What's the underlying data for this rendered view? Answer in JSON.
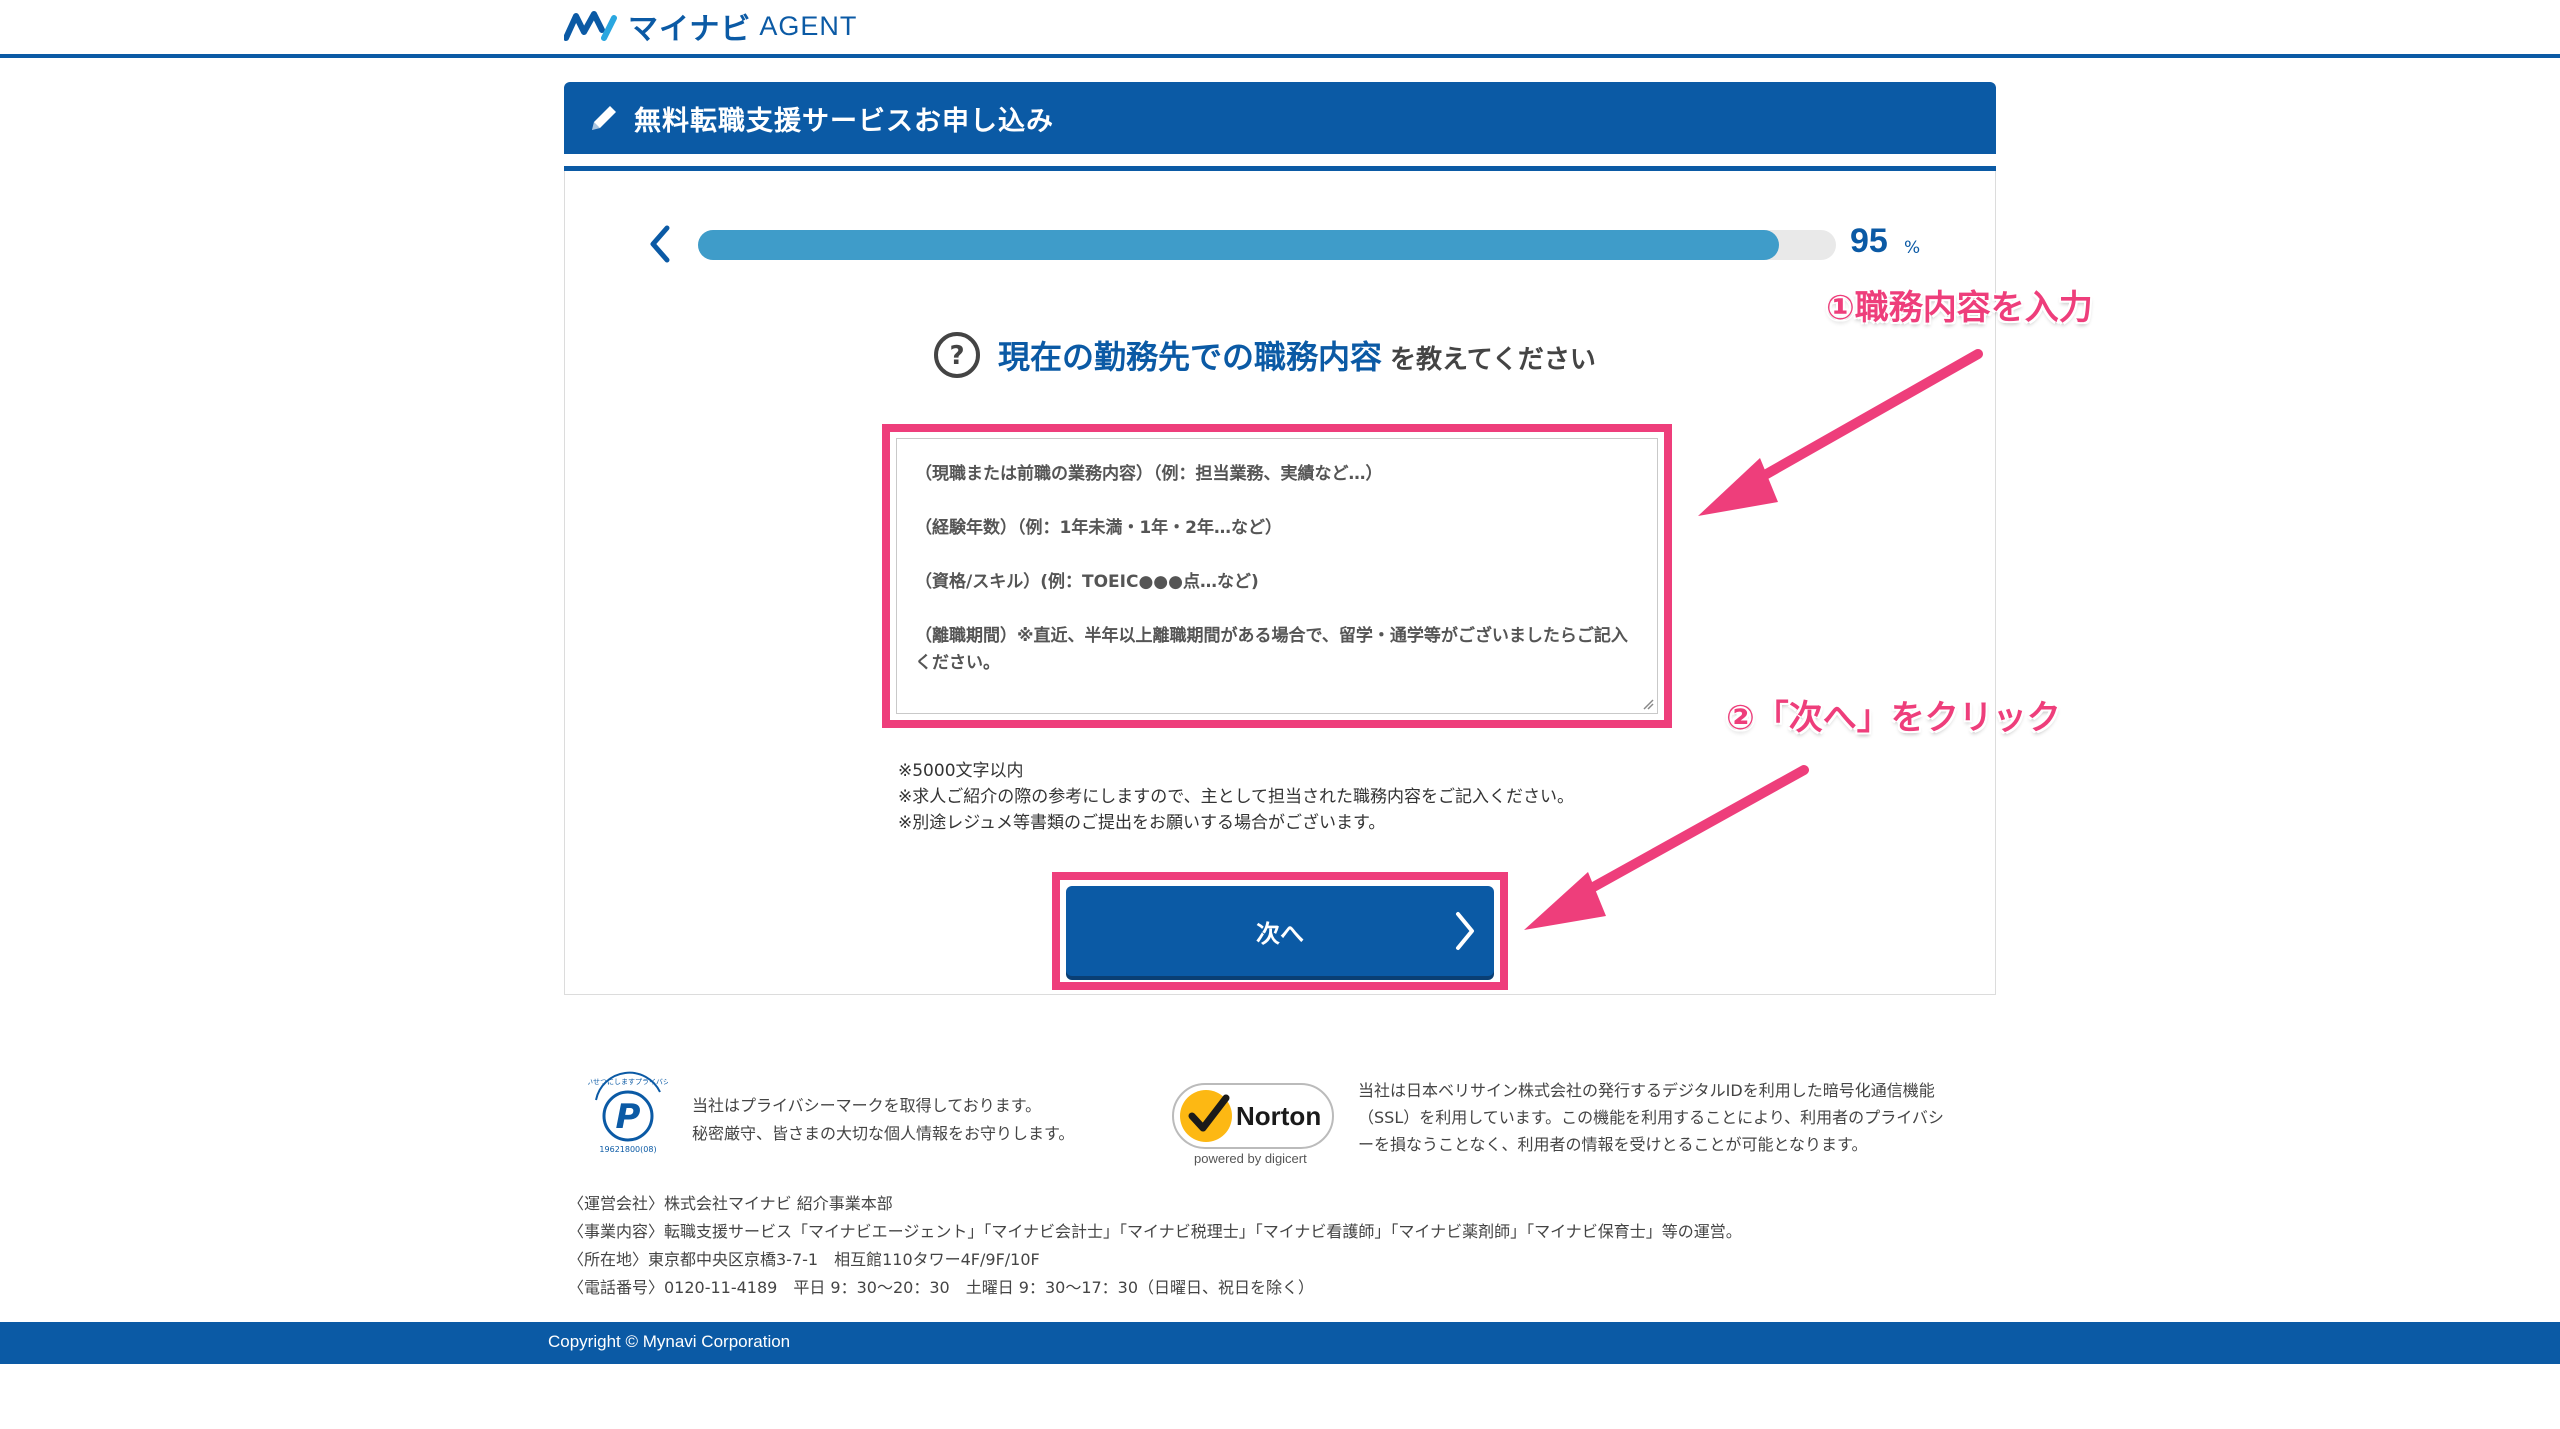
{
  "header": {
    "logo_kana": "マイナビ",
    "logo_agent": "AGENT"
  },
  "form": {
    "title": "無料転職支援サービスお申し込み",
    "progress": {
      "percent": 95,
      "value_text": "95",
      "unit": "%"
    },
    "question_main": "現在の勤務先での職務内容",
    "question_sub": "を教えてください",
    "textarea_value": "（現職または前職の業務内容）（例：担当業務、実績など…）\n\n（経験年数）（例：1年未満・1年・2年…など）\n\n（資格/スキル）(例：TOEIC●●●点…など)\n\n（離職期間）※直近、半年以上離職期間がある場合で、留学・通学等がございましたらご記入ください。",
    "notes": [
      "※5000文字以内",
      "※求人ご紹介の際の参考にしますので、主として担当された職務内容をご記入ください。",
      "※別途レジュメ等書類のご提出をお願いする場合がございます。"
    ],
    "next_label": "次へ"
  },
  "annotations": {
    "step1": "①職務内容を入力",
    "step2": "②「次へ」をクリック",
    "color": "#ee3e7b"
  },
  "trust": {
    "pmark_lines": [
      "当社はプライバシーマークを取得しております。",
      "秘密厳守、皆さまの大切な個人情報をお守りします。"
    ],
    "pmark_logo_text": "たいせつにしますプライバシー",
    "pmark_number": "19621800(08)",
    "norton_name": "Norton",
    "norton_sub": "powered by digicert",
    "ssl_text": "当社は日本ベリサイン株式会社の発行するデジタルIDを利用した暗号化通信機能（SSL）を利用しています。この機能を利用することにより、利用者のプライバシーを損なうことなく、利用者の情報を受けとることが可能となります。"
  },
  "company": [
    "〈運営会社〉株式会社マイナビ 紹介事業本部",
    "〈事業内容〉転職支援サービス「マイナビエージェント」「マイナビ会計士」「マイナビ税理士」「マイナビ看護師」「マイナビ薬剤師」「マイナビ保育士」等の運営。",
    "〈所在地〉東京都中央区京橋3-7-1　相互館110タワー4F/9F/10F",
    "〈電話番号〉0120-11-4189　平日 9：30〜20：30　土曜日 9：30〜17：30（日曜日、祝日を除く）"
  ],
  "footer": {
    "copyright": "Copyright © Mynavi Corporation"
  },
  "colors": {
    "brand": "#0b5aa5",
    "progress": "#3f9cc9",
    "highlight": "#ee3e7b"
  }
}
